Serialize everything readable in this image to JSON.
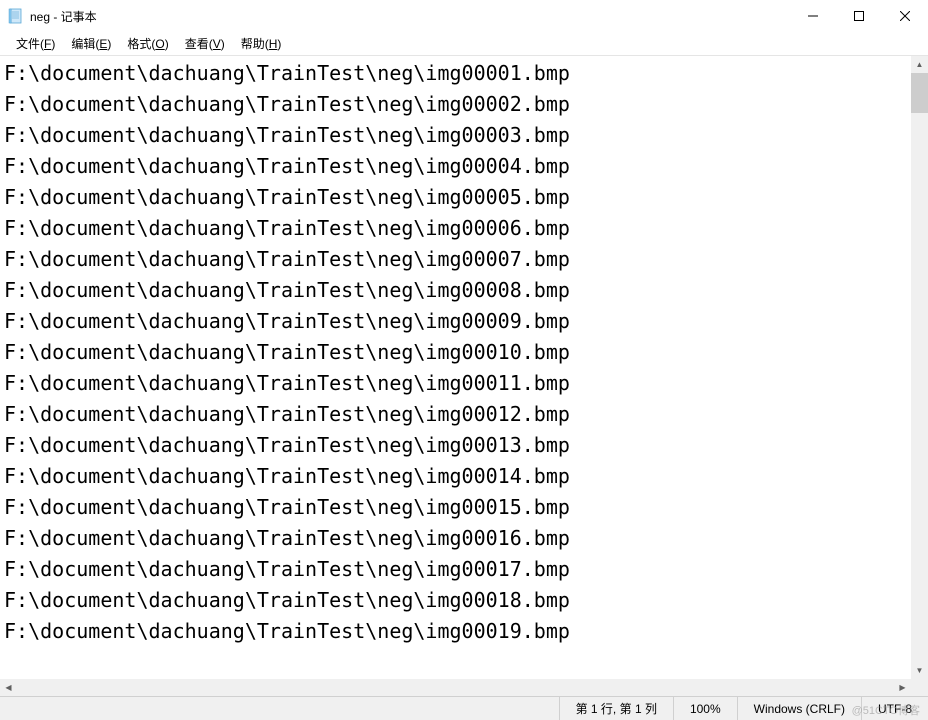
{
  "window": {
    "title": "neg - 记事本"
  },
  "menu": {
    "file": "文件(F)",
    "edit": "编辑(E)",
    "format": "格式(O)",
    "view": "查看(V)",
    "help": "帮助(H)"
  },
  "content": {
    "lines": [
      "F:\\document\\dachuang\\TrainTest\\neg\\img00001.bmp",
      "F:\\document\\dachuang\\TrainTest\\neg\\img00002.bmp",
      "F:\\document\\dachuang\\TrainTest\\neg\\img00003.bmp",
      "F:\\document\\dachuang\\TrainTest\\neg\\img00004.bmp",
      "F:\\document\\dachuang\\TrainTest\\neg\\img00005.bmp",
      "F:\\document\\dachuang\\TrainTest\\neg\\img00006.bmp",
      "F:\\document\\dachuang\\TrainTest\\neg\\img00007.bmp",
      "F:\\document\\dachuang\\TrainTest\\neg\\img00008.bmp",
      "F:\\document\\dachuang\\TrainTest\\neg\\img00009.bmp",
      "F:\\document\\dachuang\\TrainTest\\neg\\img00010.bmp",
      "F:\\document\\dachuang\\TrainTest\\neg\\img00011.bmp",
      "F:\\document\\dachuang\\TrainTest\\neg\\img00012.bmp",
      "F:\\document\\dachuang\\TrainTest\\neg\\img00013.bmp",
      "F:\\document\\dachuang\\TrainTest\\neg\\img00014.bmp",
      "F:\\document\\dachuang\\TrainTest\\neg\\img00015.bmp",
      "F:\\document\\dachuang\\TrainTest\\neg\\img00016.bmp",
      "F:\\document\\dachuang\\TrainTest\\neg\\img00017.bmp",
      "F:\\document\\dachuang\\TrainTest\\neg\\img00018.bmp",
      "F:\\document\\dachuang\\TrainTest\\neg\\img00019.bmp"
    ]
  },
  "status": {
    "position": "第 1 行, 第 1 列",
    "zoom": "100%",
    "line_ending": "Windows (CRLF)",
    "encoding": "UTF-8"
  },
  "watermark": "@51CTO博客"
}
